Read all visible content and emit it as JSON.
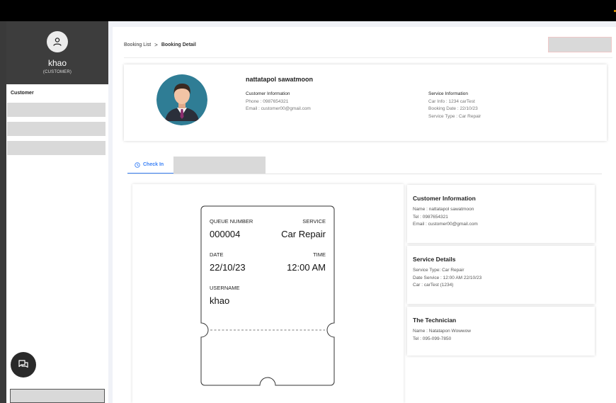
{
  "sidebar": {
    "profile": {
      "name": "khao",
      "role": "(CUSTOMER)"
    },
    "menu_title": "Customer"
  },
  "breadcrumb": {
    "parent": "Booking List",
    "separator": ">",
    "current": "Booking Detail"
  },
  "customer": {
    "name": "nattatapol sawatmoon",
    "info_title": "Customer Information",
    "phone": "Phone : 0987654321",
    "email": "Email : customer00@gmail.com"
  },
  "service": {
    "info_title": "Service Information",
    "car_info": "Car Info : 1234 carTest",
    "booking_date": "Booking Date : 22/10/23",
    "service_type": "Service Type : Car Repair"
  },
  "tabs": {
    "active_label": "Check In"
  },
  "ticket": {
    "queue_label": "QUEUE NUMBER",
    "queue_value": "000004",
    "service_label": "SERVICE",
    "service_value": "Car Repair",
    "date_label": "DATE",
    "date_value": "22/10/23",
    "time_label": "TIME",
    "time_value": "12:00 AM",
    "username_label": "USERNAME",
    "username_value": "khao"
  },
  "cards": {
    "customer": {
      "title": "Customer Information",
      "name": "Name : nattatapol sawatmoon",
      "tel": "Tel : 0987654321",
      "email": "Email : customer00@gmail.com"
    },
    "service": {
      "title": "Service Details",
      "type": "Service Type: Car Repair",
      "date": "Date Service : 12:00 AM 22/10/23",
      "car": "Car : carTest (1234)"
    },
    "technician": {
      "title": "The Technician",
      "name": "Name : Natatapon Wowwow",
      "tel": "Tel : 095-099-7850"
    }
  },
  "colors": {
    "accent": "#3b82f6",
    "sidebar_profile_bg": "#3d3d3d",
    "placeholder": "#d9d9d9"
  },
  "icons": [
    "user-icon",
    "chat-icon",
    "clock-icon",
    "avatar-illustration"
  ]
}
